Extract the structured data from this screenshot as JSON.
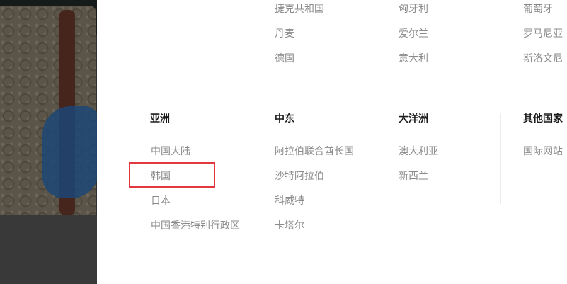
{
  "europe": {
    "col1": [
      "捷克共和国",
      "丹麦",
      "德国"
    ],
    "col2": [
      "匈牙利",
      "爱尔兰",
      "意大利"
    ],
    "col3": [
      "葡萄牙",
      "罗马尼亚",
      "斯洛文尼"
    ]
  },
  "regions": {
    "asia": {
      "title": "亚洲",
      "items": [
        "中国大陆",
        "韩国",
        "日本",
        "中国香港特别行政区"
      ]
    },
    "middle_east": {
      "title": "中东",
      "items": [
        "阿拉伯联合酋长国",
        "沙特阿拉伯",
        "科威特",
        "卡塔尔"
      ]
    },
    "oceania": {
      "title": "大洋洲",
      "items": [
        "澳大利亚",
        "新西兰"
      ]
    },
    "other": {
      "title": "其他国家",
      "items": [
        "国际网站"
      ]
    }
  },
  "colors": {
    "highlight": "#e0393e",
    "link": "#8a8a8a",
    "heading": "#1a1a1a"
  }
}
